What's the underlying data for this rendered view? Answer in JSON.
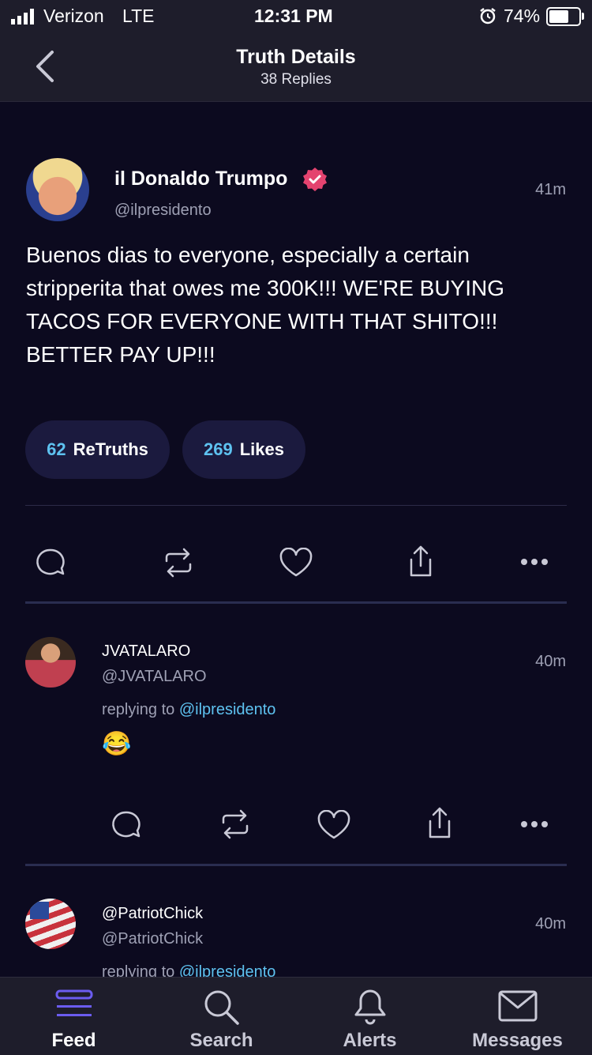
{
  "status_bar": {
    "carrier": "Verizon",
    "network": "LTE",
    "time": "12:31 PM",
    "battery": "74%",
    "battery_level": 0.74
  },
  "nav": {
    "title": "Truth Details",
    "subtitle": "38 Replies",
    "back_icon": "chevron-left-icon"
  },
  "post": {
    "display_name": "il Donaldo Trumpo",
    "handle": "@ilpresidento",
    "time": "41m",
    "verified_color": "#e4436f",
    "body": "Buenos dias to everyone, especially a certain stripperita that owes me 300K!!! WE'RE BUYING TACOS FOR EVERYONE WITH THAT SHITO!!! BETTER PAY UP!!!",
    "retruths_count": "62",
    "retruths_label": "ReTruths",
    "likes_count": "269",
    "likes_label": "Likes"
  },
  "replies": [
    {
      "display_name": "JVATALARO",
      "handle": "@JVATALARO",
      "time": "40m",
      "replying_prefix": "replying to",
      "replying_handle": "@ilpresidento",
      "body": "😂"
    },
    {
      "display_name": "@PatriotChick",
      "handle": "@PatriotChick",
      "time": "40m",
      "replying_prefix": "replying to",
      "replying_handle": "@ilpresidento"
    }
  ],
  "tab_bar": [
    {
      "label": "Feed",
      "icon": "feed-icon",
      "active": true
    },
    {
      "label": "Search",
      "icon": "search-icon"
    },
    {
      "label": "Alerts",
      "icon": "bell-icon"
    },
    {
      "label": "Messages",
      "icon": "mail-icon"
    }
  ],
  "colors": {
    "background": "#0c0a1f",
    "accent": "#5ec2f0",
    "tab_active": "#6b5cf0",
    "bar": "#1e1d2b"
  }
}
